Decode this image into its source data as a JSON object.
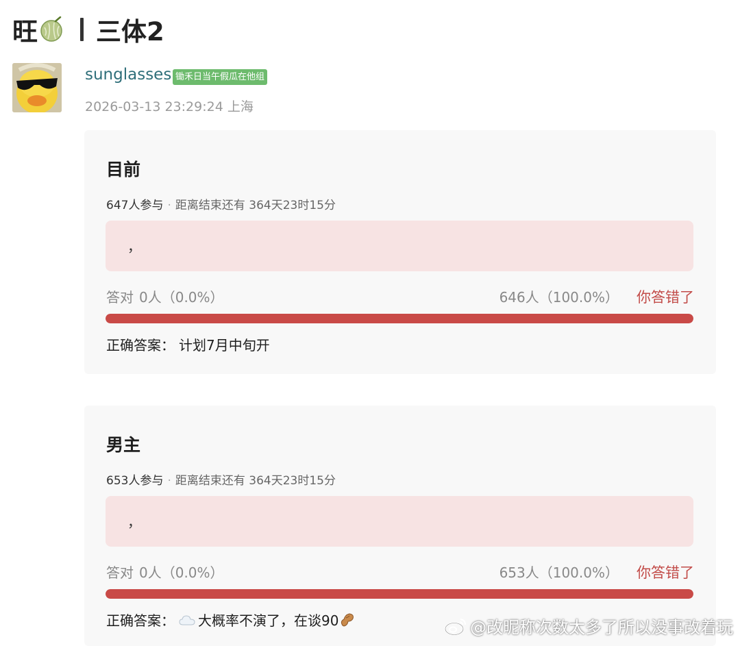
{
  "post": {
    "title_prefix": "旺",
    "title_suffix": "三体2"
  },
  "author": {
    "name": "sunglasses",
    "badge": "锄禾日当午假瓜在他组",
    "timestamp": "2026-03-13 23:29:24",
    "location": "上海"
  },
  "polls": [
    {
      "question": "目前",
      "participants": "647人参与",
      "remaining": "距离结束还有 364天23时15分",
      "selected_answer": "，",
      "correct_label": "答对",
      "correct_count": "0人（0.0%）",
      "wrong_count": "646人（100.0%）",
      "verdict": "你答错了",
      "wrong_fraction": 1.0,
      "answer_label": "正确答案：",
      "answer_text": "计划7月中旬开"
    },
    {
      "question": "男主",
      "participants": "653人参与",
      "remaining": "距离结束还有 364天23时15分",
      "selected_answer": "，",
      "correct_label": "答对",
      "correct_count": "0人（0.0%）",
      "wrong_count": "653人（100.0%）",
      "verdict": "你答错了",
      "wrong_fraction": 1.0,
      "answer_label": "正确答案：",
      "answer_text": "大概率不演了，在谈90"
    }
  ],
  "watermark": {
    "text": "@改昵称次数太多了所以没事改着玩"
  },
  "icons": {
    "title_emoji": "melon-icon",
    "answer_emoji_start": "cloud-icon",
    "answer_emoji_end": "peanut-icon",
    "watermark_logo": "weibo-icon"
  },
  "colors": {
    "accent_red": "#c94a47",
    "verdict_red": "#c24b48",
    "answer_box": "#f7e3e3",
    "badge_green": "#6dbb6d",
    "author_name": "#2f6f7a"
  }
}
